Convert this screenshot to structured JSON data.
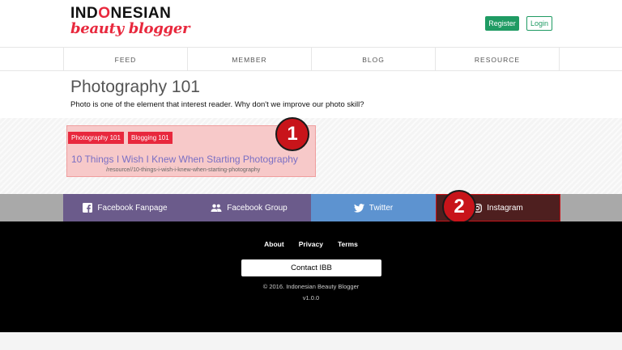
{
  "header": {
    "logo_top_pre": "IND",
    "logo_top_hl": "O",
    "logo_top_post": "NESIAN",
    "logo_bottom": "beauty blogger",
    "register_label": "Register",
    "login_label": "Login"
  },
  "nav": {
    "items": [
      {
        "label": "FEED"
      },
      {
        "label": "MEMBER"
      },
      {
        "label": "BLOG"
      },
      {
        "label": "RESOURCE"
      }
    ]
  },
  "page": {
    "title": "Photography 101",
    "description": "Photo is one of the element that interest reader. Why don't we improve our photo skill?"
  },
  "card": {
    "tags": [
      "Photography 101",
      "Blogging 101"
    ],
    "title": "10 Things I Wish I Knew When Starting Photography",
    "url": "/resource//10-things-i-wish-i-knew-when-starting-photography"
  },
  "markers": [
    "1",
    "2"
  ],
  "social": {
    "facebook_fanpage": "Facebook Fanpage",
    "facebook_group": "Facebook Group",
    "twitter": "Twitter",
    "instagram": "Instagram"
  },
  "footer": {
    "links": [
      "About",
      "Privacy",
      "Terms"
    ],
    "contact_label": "Contact IBB",
    "copyright": "© 2016. Indonesian Beauty Blogger",
    "version": "v1.0.0"
  },
  "colors": {
    "brand_red": "#e8283d",
    "brand_green": "#1f9b63",
    "facebook": "#6b5b8b",
    "twitter": "#5d93d0",
    "instagram": "#4e1f1f",
    "marker": "#c8141a"
  }
}
